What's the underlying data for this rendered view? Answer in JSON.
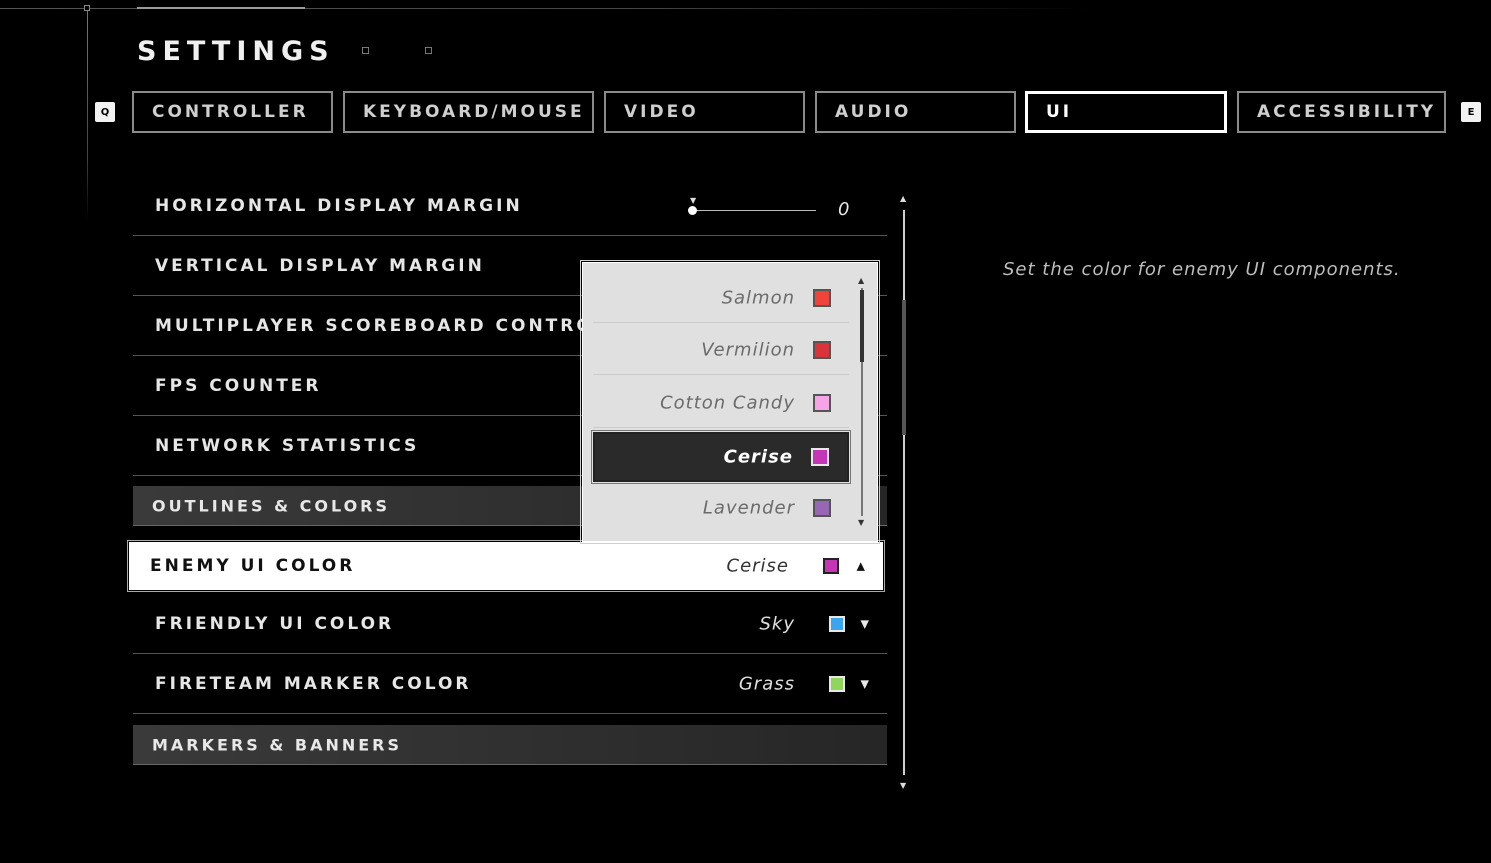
{
  "header": {
    "title": "SETTINGS",
    "left_key": "Q",
    "right_key": "E"
  },
  "tabs": [
    {
      "label": "CONTROLLER"
    },
    {
      "label": "KEYBOARD/MOUSE"
    },
    {
      "label": "VIDEO"
    },
    {
      "label": "AUDIO"
    },
    {
      "label": "UI",
      "active": true
    },
    {
      "label": "ACCESSIBILITY"
    }
  ],
  "settings": {
    "horizontal_margin": {
      "label": "HORIZONTAL DISPLAY MARGIN",
      "value": "0",
      "level": 0
    },
    "vertical_margin": {
      "label": "VERTICAL DISPLAY MARGIN"
    },
    "scoreboard": {
      "label": "MULTIPLAYER SCOREBOARD CONTROL"
    },
    "fps_counter": {
      "label": "FPS COUNTER"
    },
    "network_stats": {
      "label": "NETWORK STATISTICS"
    },
    "section_outlines": {
      "label": "OUTLINES & COLORS"
    },
    "enemy_ui_color": {
      "label": "ENEMY UI COLOR",
      "value": "Cerise",
      "color": "#c436b5"
    },
    "friendly_ui_color": {
      "label": "FRIENDLY UI COLOR",
      "value": "Sky",
      "color": "#3aa6f0"
    },
    "fireteam_marker_color": {
      "label": "FIRETEAM MARKER COLOR",
      "value": "Grass",
      "color": "#8fd65a"
    },
    "section_markers": {
      "label": "MARKERS & BANNERS"
    }
  },
  "dropdown": {
    "options": [
      {
        "label": "Salmon",
        "color": "#f0443a"
      },
      {
        "label": "Vermilion",
        "color": "#d8343a"
      },
      {
        "label": "Cotton Candy",
        "color": "#f7a3e8"
      },
      {
        "label": "Cerise",
        "color": "#c436b5",
        "selected": true
      },
      {
        "label": "Lavender",
        "color": "#9766b5"
      }
    ]
  },
  "description": "Set the color for enemy UI components."
}
